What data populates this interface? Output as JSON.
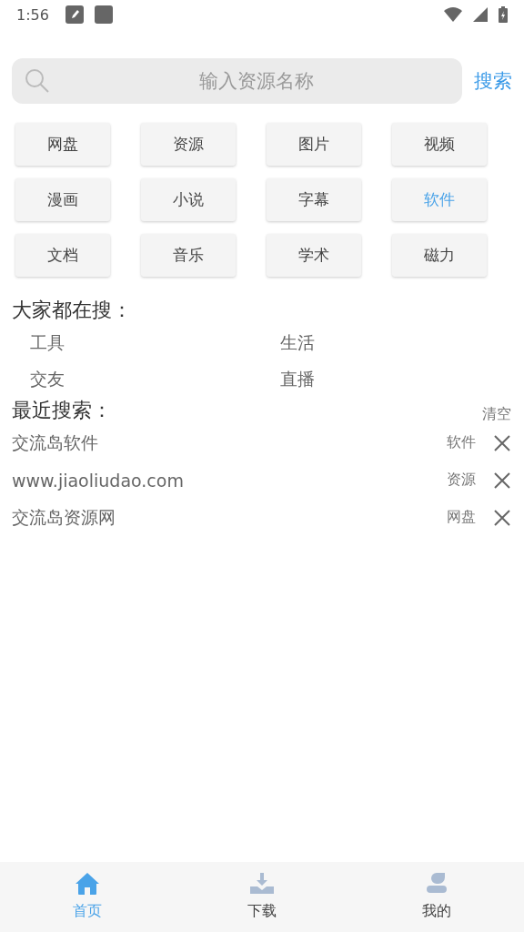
{
  "status_bar": {
    "time": "1:56"
  },
  "search": {
    "placeholder": "输入资源名称",
    "button": "搜索"
  },
  "categories": [
    {
      "label": "网盘",
      "selected": false
    },
    {
      "label": "资源",
      "selected": false
    },
    {
      "label": "图片",
      "selected": false
    },
    {
      "label": "视频",
      "selected": false
    },
    {
      "label": "漫画",
      "selected": false
    },
    {
      "label": "小说",
      "selected": false
    },
    {
      "label": "字幕",
      "selected": false
    },
    {
      "label": "软件",
      "selected": true
    },
    {
      "label": "文档",
      "selected": false
    },
    {
      "label": "音乐",
      "selected": false
    },
    {
      "label": "学术",
      "selected": false
    },
    {
      "label": "磁力",
      "selected": false
    }
  ],
  "hot": {
    "title": "大家都在搜：",
    "items": [
      "工具",
      "生活",
      "交友",
      "直播"
    ]
  },
  "recent": {
    "title": "最近搜索：",
    "clear": "清空",
    "items": [
      {
        "query": "交流岛软件",
        "category": "软件"
      },
      {
        "query": "www.jiaoliudao.com",
        "category": "资源"
      },
      {
        "query": "交流岛资源网",
        "category": "网盘"
      }
    ]
  },
  "nav": [
    {
      "label": "首页",
      "kind": "home",
      "selected": true
    },
    {
      "label": "下载",
      "kind": "download",
      "selected": false
    },
    {
      "label": "我的",
      "kind": "profile",
      "selected": false
    }
  ]
}
